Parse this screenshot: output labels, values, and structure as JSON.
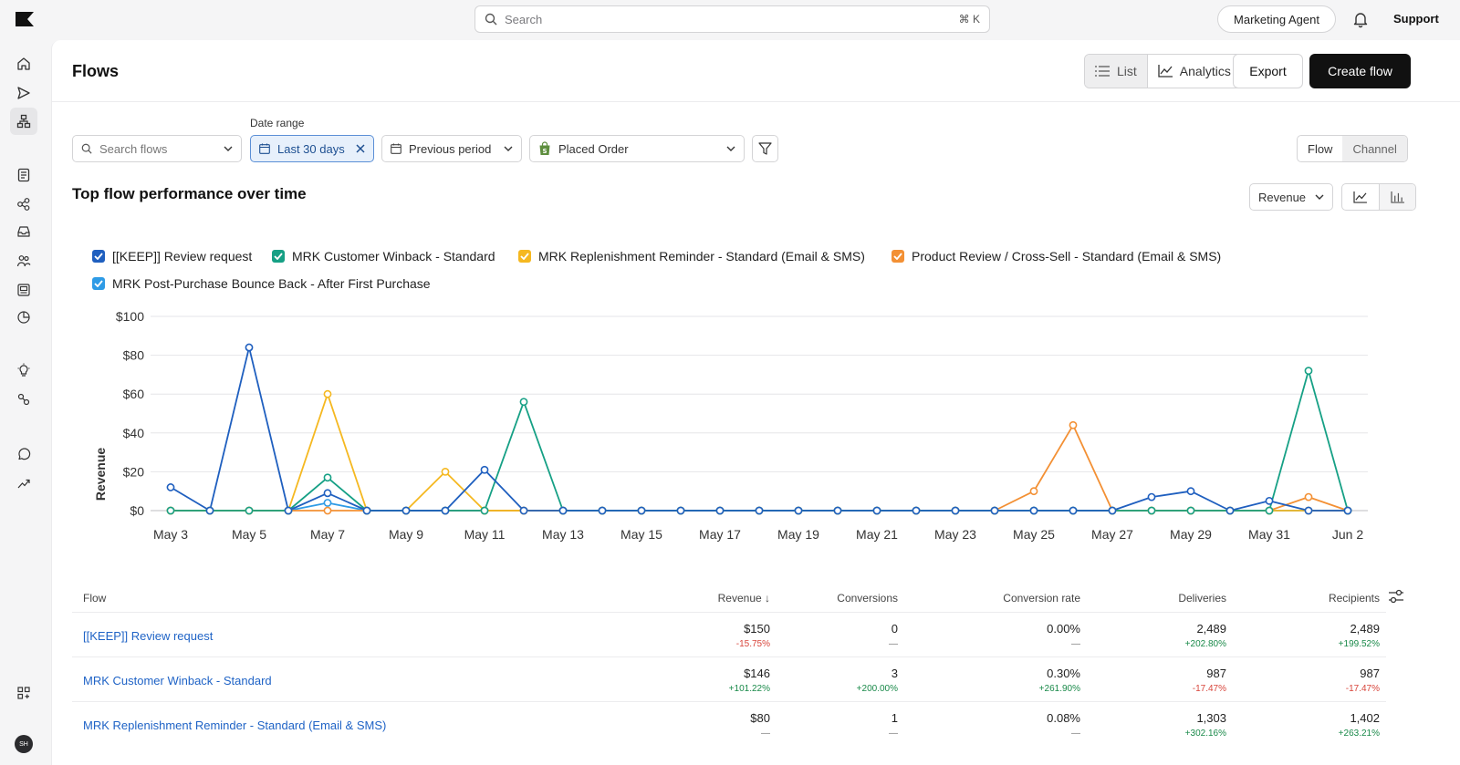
{
  "topbar": {
    "search_placeholder": "Search",
    "search_shortcut": "⌘ K",
    "agent_label": "Marketing Agent",
    "support_label": "Support"
  },
  "rail": {
    "icons": [
      "home-icon",
      "send-icon",
      "flows-icon",
      "list-icon",
      "segments-icon",
      "inbox-icon",
      "audience-icon",
      "forms-icon",
      "analytics-icon",
      "ideas-icon",
      "integrations-icon",
      "whatsapp-icon",
      "trend-icon",
      "apps-icon"
    ],
    "avatar_initials": "SH"
  },
  "header": {
    "title": "Flows",
    "view_list": "List",
    "view_analytics": "Analytics",
    "export_label": "Export",
    "create_label": "Create flow"
  },
  "filters": {
    "date_range_label": "Date range",
    "search_placeholder": "Search flows",
    "date_value": "Last 30 days",
    "compare_value": "Previous period",
    "metric_event": "Placed Order",
    "group_flow": "Flow",
    "group_channel": "Channel"
  },
  "chart_section": {
    "title": "Top flow performance over time",
    "metric": "Revenue"
  },
  "chart_data": {
    "type": "line",
    "ylabel": "Revenue",
    "ylim": [
      0,
      100
    ],
    "yticks": [
      "$0",
      "$20",
      "$40",
      "$60",
      "$80",
      "$100"
    ],
    "x": [
      "May 3",
      "May 4",
      "May 5",
      "May 6",
      "May 7",
      "May 8",
      "May 9",
      "May 10",
      "May 11",
      "May 12",
      "May 13",
      "May 14",
      "May 15",
      "May 16",
      "May 17",
      "May 18",
      "May 19",
      "May 20",
      "May 21",
      "May 22",
      "May 23",
      "May 24",
      "May 25",
      "May 26",
      "May 27",
      "May 28",
      "May 29",
      "May 30",
      "May 31",
      "Jun 1",
      "Jun 2"
    ],
    "xtick_labels": [
      "May 3",
      "May 5",
      "May 7",
      "May 9",
      "May 11",
      "May 13",
      "May 15",
      "May 17",
      "May 19",
      "May 21",
      "May 23",
      "May 25",
      "May 27",
      "May 29",
      "May 31",
      "Jun 2"
    ],
    "grid": true,
    "legend_position": "top-left",
    "series": [
      {
        "name": "[[KEEP]] Review request",
        "color": "#1f5fbf",
        "values": [
          12,
          0,
          84,
          0,
          9,
          0,
          0,
          0,
          21,
          0,
          0,
          0,
          0,
          0,
          0,
          0,
          0,
          0,
          0,
          0,
          0,
          0,
          0,
          0,
          0,
          7,
          10,
          0,
          5,
          0,
          0
        ]
      },
      {
        "name": "MRK Customer Winback - Standard",
        "color": "#16a085",
        "values": [
          0,
          0,
          0,
          0,
          17,
          0,
          0,
          0,
          0,
          56,
          0,
          0,
          0,
          0,
          0,
          0,
          0,
          0,
          0,
          0,
          0,
          0,
          0,
          0,
          0,
          0,
          0,
          0,
          0,
          72,
          0
        ]
      },
      {
        "name": "MRK Replenishment Reminder - Standard (Email & SMS)",
        "color": "#f5b820",
        "values": [
          0,
          0,
          0,
          0,
          60,
          0,
          0,
          20,
          0,
          0,
          0,
          0,
          0,
          0,
          0,
          0,
          0,
          0,
          0,
          0,
          0,
          0,
          0,
          0,
          0,
          0,
          0,
          0,
          0,
          0,
          0
        ]
      },
      {
        "name": "Product Review / Cross-Sell - Standard (Email & SMS)",
        "color": "#f39034",
        "values": [
          0,
          0,
          0,
          0,
          0,
          0,
          0,
          0,
          0,
          0,
          0,
          0,
          0,
          0,
          0,
          0,
          0,
          0,
          0,
          0,
          0,
          0,
          10,
          44,
          0,
          0,
          0,
          0,
          0,
          7,
          0
        ]
      },
      {
        "name": "MRK Post-Purchase Bounce Back - After First Purchase",
        "color": "#2e9be6",
        "values": [
          0,
          0,
          0,
          0,
          4,
          0,
          0,
          0,
          0,
          0,
          0,
          0,
          0,
          0,
          0,
          0,
          0,
          0,
          0,
          0,
          0,
          0,
          0,
          0,
          0,
          0,
          0,
          0,
          0,
          0,
          0
        ]
      }
    ]
  },
  "table": {
    "headers": [
      "Flow",
      "Revenue ↓",
      "Conversions",
      "Conversion rate",
      "Deliveries",
      "Recipients"
    ],
    "rows": [
      {
        "name": "[[KEEP]] Review request",
        "revenue": "$150",
        "revenue_d": "-15.75%",
        "conv": "0",
        "conv_d": "—",
        "rate": "0.00%",
        "rate_d": "—",
        "deliv": "2,489",
        "deliv_d": "+202.80%",
        "recip": "2,489",
        "recip_d": "+199.52%"
      },
      {
        "name": "MRK Customer Winback - Standard",
        "revenue": "$146",
        "revenue_d": "+101.22%",
        "conv": "3",
        "conv_d": "+200.00%",
        "rate": "0.30%",
        "rate_d": "+261.90%",
        "deliv": "987",
        "deliv_d": "-17.47%",
        "recip": "987",
        "recip_d": "-17.47%"
      },
      {
        "name": "MRK Replenishment Reminder - Standard (Email & SMS)",
        "revenue": "$80",
        "revenue_d": "—",
        "conv": "1",
        "conv_d": "—",
        "rate": "0.08%",
        "rate_d": "—",
        "deliv": "1,303",
        "deliv_d": "+302.16%",
        "recip": "1,402",
        "recip_d": "+263.21%"
      }
    ]
  }
}
